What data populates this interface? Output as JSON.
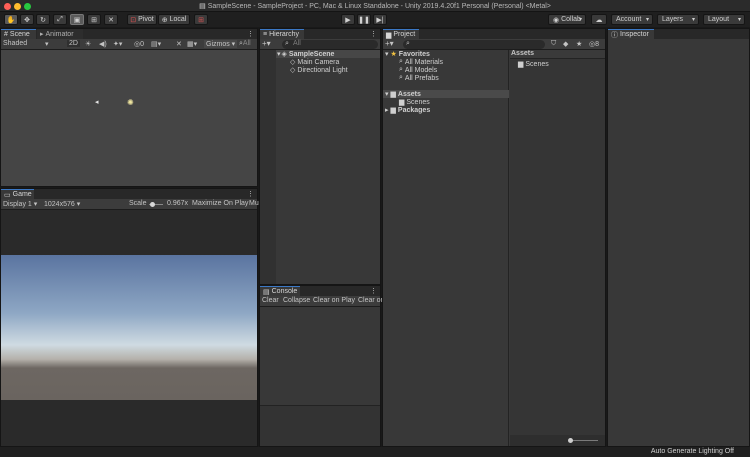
{
  "window": {
    "title": "SampleScene - SampleProject - PC, Mac & Linux Standalone - Unity 2019.4.20f1 Personal (Personal) <Metal>"
  },
  "toolbar": {
    "pivot_label": "Pivot",
    "local_label": "Local",
    "collab_label": "Collab",
    "account_label": "Account",
    "layers_label": "Layers",
    "layout_label": "Layout"
  },
  "scene_panel": {
    "tabs": [
      "Scene",
      "Animator"
    ],
    "shading_mode": "Shaded",
    "mode_2d": "2D",
    "effects_count": "0",
    "gizmos_label": "Gizmos",
    "search_placeholder": "All"
  },
  "game_panel": {
    "tab": "Game",
    "display": "Display 1",
    "resolution": "1024x576",
    "scale_label": "Scale",
    "scale_value": "0.967x",
    "maximize_label": "Maximize On Play",
    "mute_label": "Mu"
  },
  "hierarchy": {
    "tab": "Hierarchy",
    "search_placeholder": "All",
    "scene": "SampleScene",
    "items": [
      "Main Camera",
      "Directional Light"
    ]
  },
  "console": {
    "tab": "Console",
    "buttons": [
      "Clear",
      "Collapse",
      "Clear on Play",
      "Clear or"
    ]
  },
  "project": {
    "tab": "Project",
    "hidden_count": "8",
    "favorites_label": "Favorites",
    "favorites": [
      "All Materials",
      "All Models",
      "All Prefabs"
    ],
    "assets_label": "Assets",
    "assets_children": [
      "Scenes"
    ],
    "packages_label": "Packages",
    "breadcrumb": "Assets",
    "grid_items": [
      "Scenes"
    ]
  },
  "inspector": {
    "tab": "Inspector"
  },
  "statusbar": {
    "message": "Auto Generate Lighting Off"
  },
  "colors": {
    "accent": "#3b78c5",
    "selection": "#2c5d87",
    "panel": "#383838",
    "sky_top": "#5e7aa5",
    "ground": "#6c6661"
  }
}
